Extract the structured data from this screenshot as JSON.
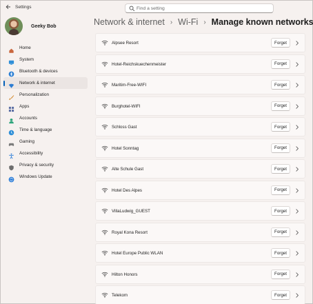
{
  "app": {
    "title": "Settings"
  },
  "search": {
    "placeholder": "Find a setting"
  },
  "user": {
    "name": "Geeky Bob"
  },
  "sidebar": {
    "items": [
      {
        "label": "Home",
        "icon": "home-icon",
        "color": "#c9663d"
      },
      {
        "label": "System",
        "icon": "system-icon",
        "color": "#2f8fd8"
      },
      {
        "label": "Bluetooth & devices",
        "icon": "bluetooth-icon",
        "color": "#2b7fd4"
      },
      {
        "label": "Network & internet",
        "icon": "wifi-icon",
        "color": "#2d7dd2",
        "active": true
      },
      {
        "label": "Personalization",
        "icon": "brush-icon",
        "color": "#d28a2f"
      },
      {
        "label": "Apps",
        "icon": "apps-icon",
        "color": "#5a6ea3"
      },
      {
        "label": "Accounts",
        "icon": "person-icon",
        "color": "#2fa57c"
      },
      {
        "label": "Time & language",
        "icon": "globe-clock-icon",
        "color": "#2f8fd8"
      },
      {
        "label": "Gaming",
        "icon": "gamepad-icon",
        "color": "#7a7a7a"
      },
      {
        "label": "Accessibility",
        "icon": "accessibility-icon",
        "color": "#2f7fd8"
      },
      {
        "label": "Privacy & security",
        "icon": "shield-icon",
        "color": "#6d6d6d"
      },
      {
        "label": "Windows Update",
        "icon": "update-icon",
        "color": "#2f7fd8"
      }
    ]
  },
  "header": {
    "crumbs": [
      "Network & internet",
      "Wi-Fi",
      "Manage known networks"
    ]
  },
  "networks": [
    "Alpsee Resort",
    "Hotel-Reichskuechenmeister",
    "Maritim-Free-WIFI",
    "Burghotel-WIFI",
    "Schloss Gast",
    "Hotel Sonntag",
    "Alte Schule Gast",
    "Hotel Des Alpes",
    "VillaLudwig_GUEST",
    "Royal Kona Resort",
    "Hotel Europe Public WLAN",
    "Hilton Honors",
    "Telekom"
  ],
  "actions": {
    "forget_label": "Forget"
  },
  "colors": {
    "accent": "#005fb8",
    "background": "#f6f1ef",
    "card": "#fbf8f7"
  }
}
